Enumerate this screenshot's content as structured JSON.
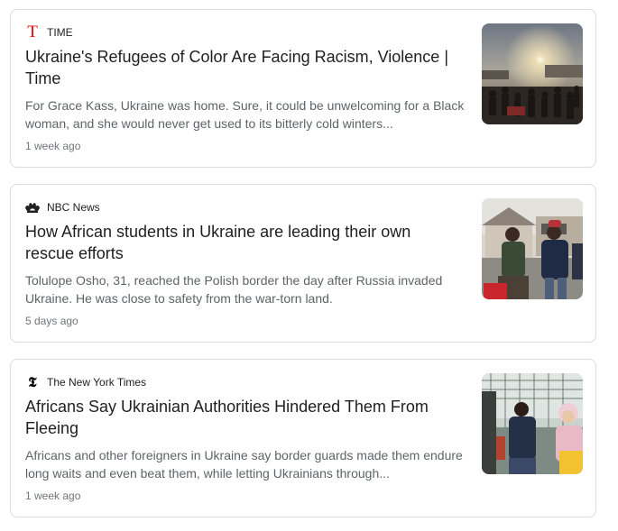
{
  "articles": [
    {
      "source": "TIME",
      "source_logo": "time-logo-icon",
      "headline": "Ukraine's Refugees of Color Are Facing Racism, Violence | Time",
      "snippet": "For Grace Kass, Ukraine was home. Sure, it could be unwelcoming for a Black woman, and she would never get used to its bitterly cold winters...",
      "age": "1 week ago",
      "thumbnail": "crowd-at-sunset-image"
    },
    {
      "source": "NBC News",
      "source_logo": "nbc-peacock-icon",
      "headline": "How African students in Ukraine are leading their own rescue efforts",
      "snippet": "Tolulope Osho, 31, reached the Polish border the day after Russia invaded Ukraine. He was close to safety from the war-torn land.",
      "age": "5 days ago",
      "thumbnail": "students-at-border-image"
    },
    {
      "source": "The New York Times",
      "source_logo": "nyt-t-icon",
      "headline": "Africans Say Ukrainian Authorities Hindered Them From Fleeing",
      "snippet": "Africans and other foreigners in Ukraine say border guards made them endure long waits and even beat them, while letting Ukrainians through...",
      "age": "1 week ago",
      "thumbnail": "people-waiting-at-fence-image"
    }
  ],
  "colors": {
    "time_red": "#e90606",
    "border": "#dadce0",
    "snippet_gray": "#5f6368"
  }
}
